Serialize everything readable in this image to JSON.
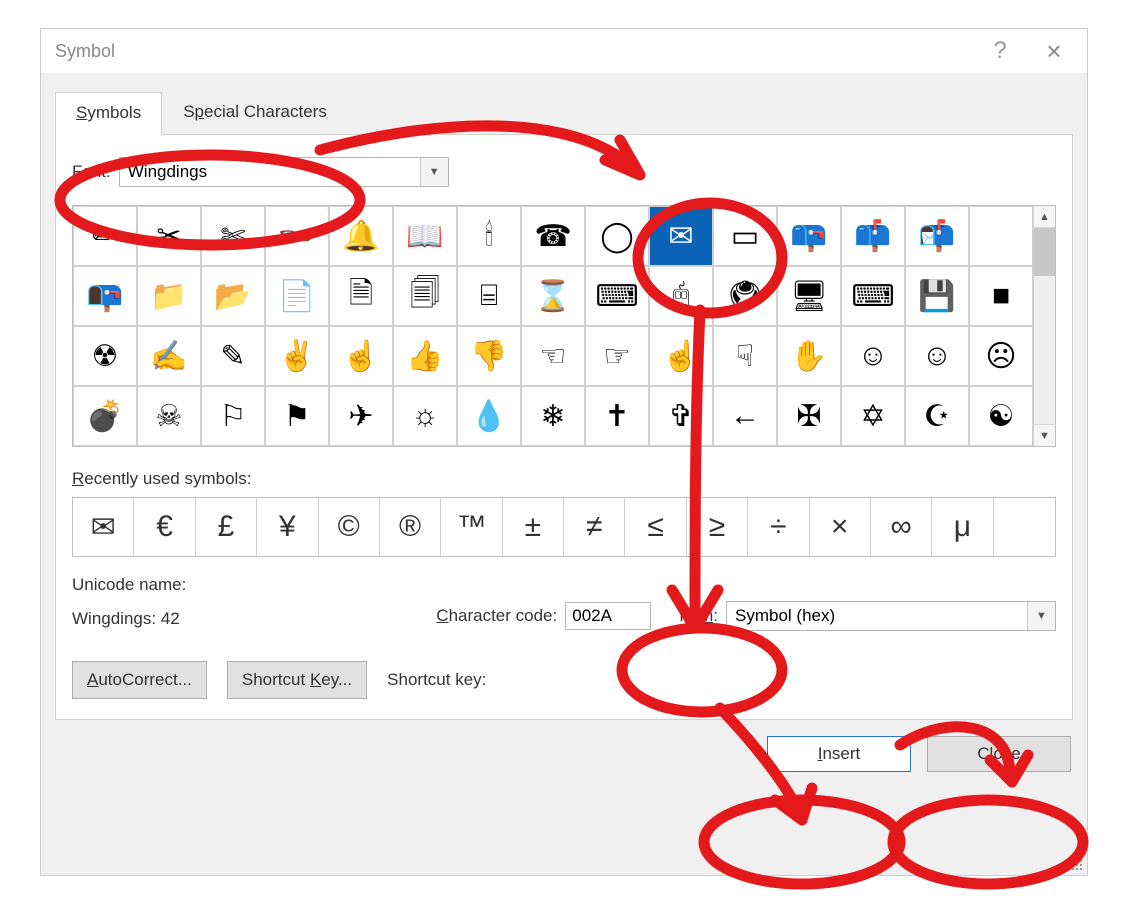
{
  "dialog": {
    "title": "Symbol",
    "help_icon": "?",
    "close_icon": "×"
  },
  "tabs": {
    "symbols": "Symbols",
    "special": "Special Characters"
  },
  "font": {
    "label": "Font:",
    "value": "Wingdings"
  },
  "grid": {
    "rows": [
      [
        "✏",
        "✂",
        "✄",
        "👓",
        "🔔",
        "📖",
        "🕯",
        "☎",
        "◯",
        "✉",
        "▭",
        "📪",
        "📫",
        "📬"
      ],
      [
        "📭",
        "📁",
        "📂",
        "📄",
        "🗎",
        "🗐",
        "⌸",
        "⌛",
        "⌨",
        "🖰",
        "🖲",
        "🖥",
        "⌨",
        "💾",
        "■"
      ],
      [
        "☢",
        "✍",
        "✎",
        "✌",
        "☝",
        "👍",
        "👎",
        "☜",
        "☞",
        "☝",
        "☟",
        "✋",
        "☺",
        "☺",
        "☹"
      ],
      [
        "💣",
        "☠",
        "⚐",
        "⚑",
        "✈",
        "☼",
        "💧",
        "❄",
        "✝",
        "✞",
        "←",
        "✠",
        "✡",
        "☪",
        "☯"
      ]
    ],
    "selected_row": 0,
    "selected_col": 9
  },
  "recent": {
    "label": "Recently used symbols:",
    "items": [
      "✉",
      "€",
      "£",
      "¥",
      "©",
      "®",
      "™",
      "±",
      "≠",
      "≤",
      "≥",
      "÷",
      "×",
      "∞",
      "μ",
      ""
    ]
  },
  "info": {
    "unicode_name_label": "Unicode name:",
    "unicode_name_value": "Wingdings: 42",
    "char_code_label": "Character code:",
    "char_code_value": "002A",
    "from_label": "from:",
    "from_value": "Symbol (hex)"
  },
  "buttons": {
    "autocorrect": "AutoCorrect...",
    "shortcut_key": "Shortcut Key...",
    "shortcut_key_label": "Shortcut key:"
  },
  "footer": {
    "insert": "Insert",
    "close": "Close"
  }
}
